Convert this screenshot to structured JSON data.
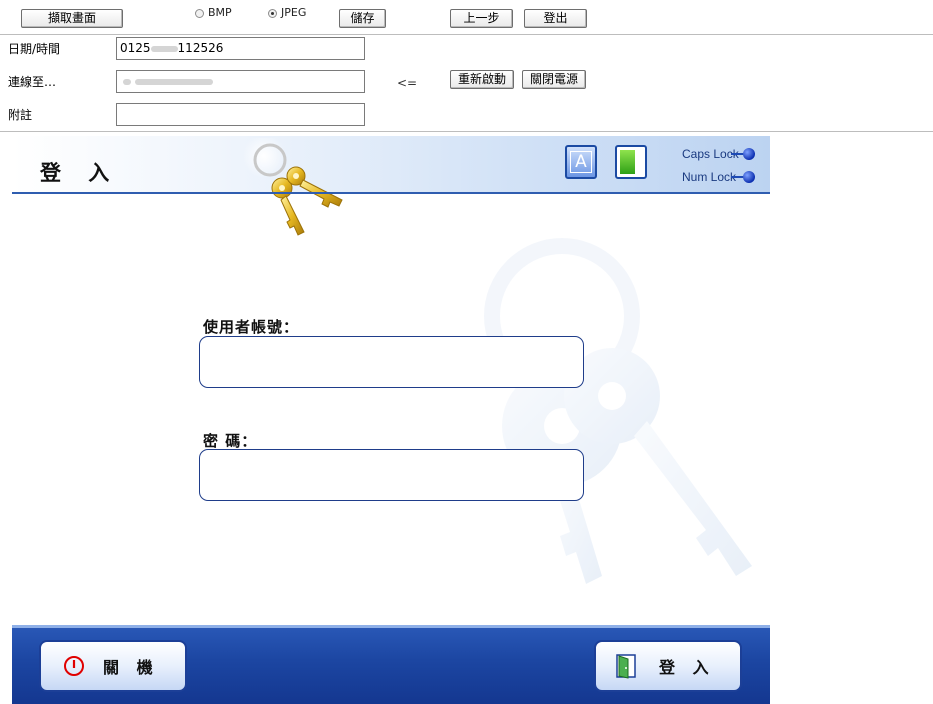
{
  "toolbar": {
    "capture_label": "擷取畫面",
    "format_options": [
      {
        "label": "BMP",
        "selected": false
      },
      {
        "label": "JPEG",
        "selected": true
      }
    ],
    "save_label": "儲存",
    "back_label": "上一步",
    "logout_label": "登出",
    "datetime_label": "日期/時間",
    "datetime_prefix": "0125",
    "datetime_suffix": "112526",
    "connect_label": "連線至…",
    "arrow_text": "<=",
    "restart_label": "重新啟動",
    "power_off_label": "關閉電源",
    "note_label": "附註",
    "note_value": ""
  },
  "login": {
    "title": "登 入",
    "caps_lock_label": "Caps Lock",
    "num_lock_label": "Num Lock",
    "caps_glyph": "A",
    "username_label": "使用者帳號：",
    "username_value": "",
    "password_label": "密 碼：",
    "password_value": "",
    "shutdown_label": "關 機",
    "login_label": "登 入"
  },
  "colors": {
    "header_accent": "#2f5db0",
    "footer_blue": "#1c46a2",
    "input_border": "#1f3d8a",
    "power_red": "#e00000",
    "key_gold": "#e0b420"
  },
  "icons": [
    "keys-icon",
    "caps-lock-icon",
    "num-lock-icon",
    "power-icon",
    "door-icon",
    "watermark-keys-icon"
  ]
}
